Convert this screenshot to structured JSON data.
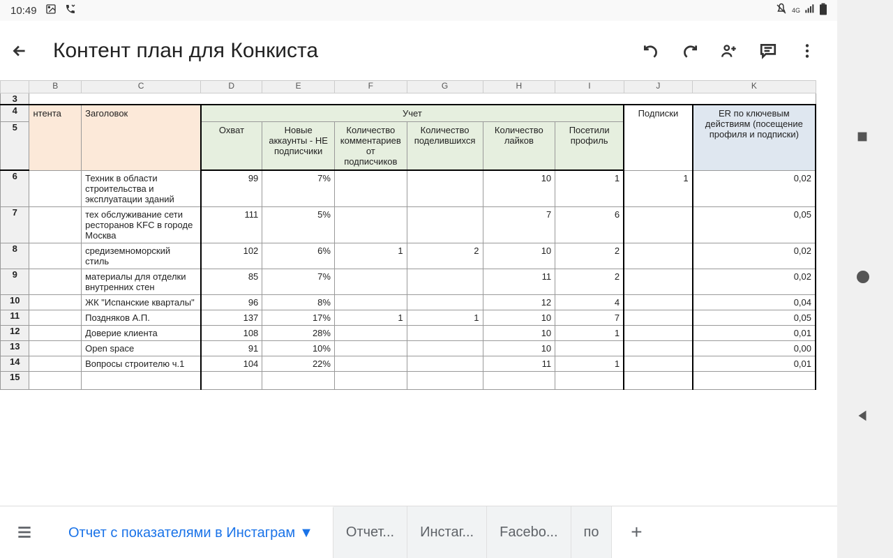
{
  "status": {
    "time": "10:49",
    "network": "4G"
  },
  "header": {
    "title": "Контент план для Конкиста"
  },
  "columns": {
    "rownum": "",
    "B": "B",
    "C": "C",
    "D": "D",
    "E": "E",
    "F": "F",
    "G": "G",
    "H": "H",
    "I": "I",
    "J": "J",
    "K": "K"
  },
  "rowNums": {
    "r3": "3",
    "r4": "4",
    "r5": "5",
    "r6": "6",
    "r7": "7",
    "r8": "8",
    "r9": "9",
    "r10": "10",
    "r11": "11",
    "r12": "12",
    "r13": "13",
    "r14": "14",
    "r15": "15"
  },
  "headers": {
    "b_partial": "нтента",
    "c": "Заголовок",
    "d_merge_top": "Учет",
    "d": "Охват",
    "e": "Новые аккаунты - НЕ подписчики",
    "f": "Количество комментариев от подписчиков",
    "g": "Количество поделившихся",
    "h": "Количество лайков",
    "i": "Посетили профиль",
    "j": "Подписки",
    "k": "ER по ключевым действиям (посещение профиля и подписки)"
  },
  "rows": [
    {
      "c": "Техник в области строительства и эксплуатации зданий",
      "d": "99",
      "e": "7%",
      "f": "",
      "g": "",
      "h": "10",
      "i": "1",
      "j": "1",
      "k": "0,02"
    },
    {
      "c": "тех обслуживание сети ресторанов KFC в городе Москва",
      "d": "111",
      "e": "5%",
      "f": "",
      "g": "",
      "h": "7",
      "i": "6",
      "j": "",
      "k": "0,05"
    },
    {
      "c": "средиземноморский стиль",
      "d": "102",
      "e": "6%",
      "f": "1",
      "g": "2",
      "h": "10",
      "i": "2",
      "j": "",
      "k": "0,02"
    },
    {
      "c": "материалы для отделки внутренних стен",
      "d": "85",
      "e": "7%",
      "f": "",
      "g": "",
      "h": "11",
      "i": "2",
      "j": "",
      "k": "0,02"
    },
    {
      "c": "ЖК \"Испанские кварталы\"",
      "d": "96",
      "e": "8%",
      "f": "",
      "g": "",
      "h": "12",
      "i": "4",
      "j": "",
      "k": "0,04"
    },
    {
      "c": "Поздняков А.П.",
      "d": "137",
      "e": "17%",
      "f": "1",
      "g": "1",
      "h": "10",
      "i": "7",
      "j": "",
      "k": "0,05"
    },
    {
      "c": "Доверие клиента",
      "d": "108",
      "e": "28%",
      "f": "",
      "g": "",
      "h": "10",
      "i": "1",
      "j": "",
      "k": "0,01"
    },
    {
      "c": "Open space",
      "d": "91",
      "e": "10%",
      "f": "",
      "g": "",
      "h": "10",
      "i": "",
      "j": "",
      "k": "0,00"
    },
    {
      "c": "Вопросы строителю ч.1",
      "d": "104",
      "e": "22%",
      "f": "",
      "g": "",
      "h": "11",
      "i": "1",
      "j": "",
      "k": "0,01"
    }
  ],
  "tabs": {
    "active": "Отчет с показателями в Инстаграм",
    "others": [
      "Отчет...",
      "Инстаг...",
      "Facebo...",
      "по"
    ]
  }
}
